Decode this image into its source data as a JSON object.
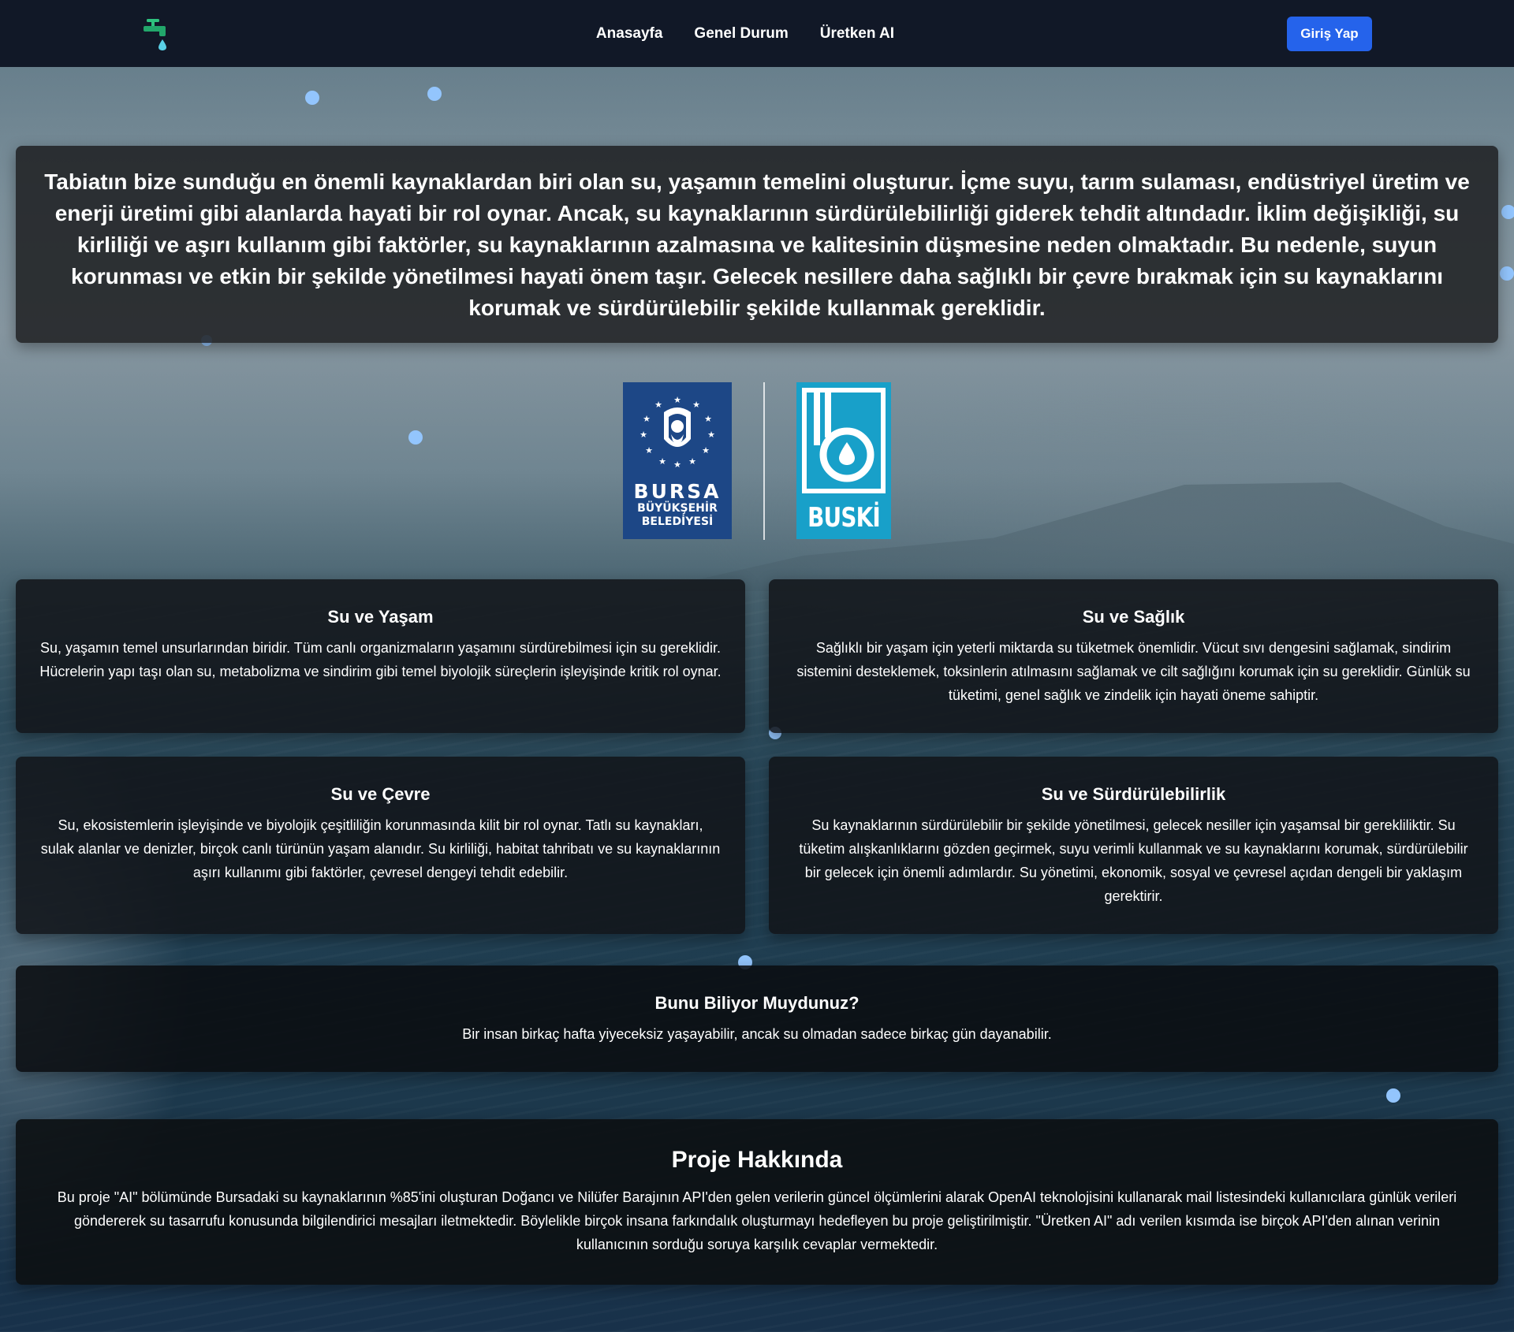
{
  "nav": {
    "links": [
      "Anasayfa",
      "Genel Durum",
      "Üretken AI"
    ],
    "login_label": "Giriş Yap"
  },
  "intro": {
    "text": "Tabiatın bize sunduğu en önemli kaynaklardan biri olan su, yaşamın temelini oluşturur. İçme suyu, tarım sulaması, endüstriyel üretim ve enerji üretimi gibi alanlarda hayati bir rol oynar. Ancak, su kaynaklarının sürdürülebilirliği giderek tehdit altındadır. İklim değişikliği, su kirliliği ve aşırı kullanım gibi faktörler, su kaynaklarının azalmasına ve kalitesinin düşmesine neden olmaktadır. Bu nedenle, suyun korunması ve etkin bir şekilde yönetilmesi hayati önem taşır. Gelecek nesillere daha sağlıklı bir çevre bırakmak için su kaynaklarını korumak ve sürdürülebilir şekilde kullanmak gereklidir."
  },
  "logos": {
    "bursa": {
      "line1": "BURSA",
      "line2": "BÜYÜKŞEHİR",
      "line3": "BELEDİYESİ",
      "color": "#1d4786"
    },
    "buski": {
      "text": "BUSKİ",
      "color": "#18a0c9"
    }
  },
  "cards": [
    {
      "title": "Su ve Yaşam",
      "text": "Su, yaşamın temel unsurlarından biridir. Tüm canlı organizmaların yaşamını sürdürebilmesi için su gereklidir. Hücrelerin yapı taşı olan su, metabolizma ve sindirim gibi temel biyolojik süreçlerin işleyişinde kritik rol oynar."
    },
    {
      "title": "Su ve Sağlık",
      "text": "Sağlıklı bir yaşam için yeterli miktarda su tüketmek önemlidir. Vücut sıvı dengesini sağlamak, sindirim sistemini desteklemek, toksinlerin atılmasını sağlamak ve cilt sağlığını korumak için su gereklidir. Günlük su tüketimi, genel sağlık ve zindelik için hayati öneme sahiptir."
    },
    {
      "title": "Su ve Çevre",
      "text": "Su, ekosistemlerin işleyişinde ve biyolojik çeşitliliğin korunmasında kilit bir rol oynar. Tatlı su kaynakları, sulak alanlar ve denizler, birçok canlı türünün yaşam alanıdır. Su kirliliği, habitat tahribatı ve su kaynaklarının aşırı kullanımı gibi faktörler, çevresel dengeyi tehdit edebilir."
    },
    {
      "title": "Su ve Sürdürülebilirlik",
      "text": "Su kaynaklarının sürdürülebilir bir şekilde yönetilmesi, gelecek nesiller için yaşamsal bir gerekliliktir. Su tüketim alışkanlıklarını gözden geçirmek, suyu verimli kullanmak ve su kaynaklarını korumak, sürdürülebilir bir gelecek için önemli adımlardır. Su yönetimi, ekonomik, sosyal ve çevresel açıdan dengeli bir yaklaşım gerektirir."
    },
    {
      "title": "Bunu Biliyor Muydunuz?",
      "text": "Bir insan birkaç hafta yiyeceksiz yaşayabilir, ancak su olmadan sadece birkaç gün dayanabilir."
    }
  ],
  "about": {
    "title": "Proje Hakkında",
    "text": "Bu proje \"AI\" bölümünde Bursadaki su kaynaklarının %85'ini oluşturan Doğancı ve Nilüfer Barajının API'den gelen verilerin güncel ölçümlerini alarak OpenAI teknolojisini kullanarak mail listesindeki kullanıcılara günlük verileri göndererek su tasarrufu konusunda bilgilendirici mesajları iletmektedir. Böylelikle birçok insana farkındalık oluşturmayı hedefleyen bu proje geliştirilmiştir. \"Üretken AI\" adı verilen kısımda ise birçok API'den alınan verinin kullanıcının sorduğu soruya karşılık cevaplar vermektedir."
  },
  "colors": {
    "navbar": "#111827",
    "accent": "#2563eb",
    "dot": "#93c5fd"
  },
  "icons": {
    "site_logo": "water-tap-icon"
  }
}
